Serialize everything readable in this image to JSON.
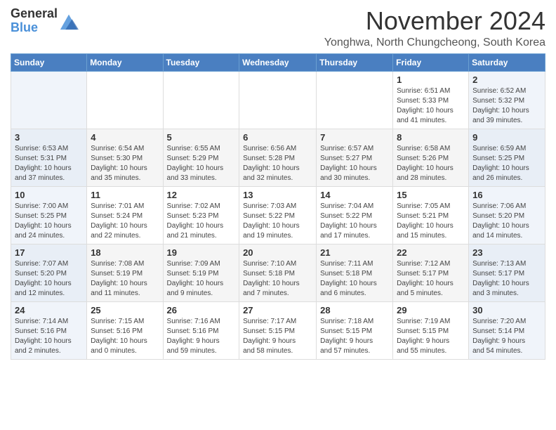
{
  "header": {
    "logo_general": "General",
    "logo_blue": "Blue",
    "month_title": "November 2024",
    "location": "Yonghwa, North Chungcheong, South Korea"
  },
  "weekdays": [
    "Sunday",
    "Monday",
    "Tuesday",
    "Wednesday",
    "Thursday",
    "Friday",
    "Saturday"
  ],
  "weeks": [
    [
      {
        "day": "",
        "info": ""
      },
      {
        "day": "",
        "info": ""
      },
      {
        "day": "",
        "info": ""
      },
      {
        "day": "",
        "info": ""
      },
      {
        "day": "",
        "info": ""
      },
      {
        "day": "1",
        "info": "Sunrise: 6:51 AM\nSunset: 5:33 PM\nDaylight: 10 hours\nand 41 minutes."
      },
      {
        "day": "2",
        "info": "Sunrise: 6:52 AM\nSunset: 5:32 PM\nDaylight: 10 hours\nand 39 minutes."
      }
    ],
    [
      {
        "day": "3",
        "info": "Sunrise: 6:53 AM\nSunset: 5:31 PM\nDaylight: 10 hours\nand 37 minutes."
      },
      {
        "day": "4",
        "info": "Sunrise: 6:54 AM\nSunset: 5:30 PM\nDaylight: 10 hours\nand 35 minutes."
      },
      {
        "day": "5",
        "info": "Sunrise: 6:55 AM\nSunset: 5:29 PM\nDaylight: 10 hours\nand 33 minutes."
      },
      {
        "day": "6",
        "info": "Sunrise: 6:56 AM\nSunset: 5:28 PM\nDaylight: 10 hours\nand 32 minutes."
      },
      {
        "day": "7",
        "info": "Sunrise: 6:57 AM\nSunset: 5:27 PM\nDaylight: 10 hours\nand 30 minutes."
      },
      {
        "day": "8",
        "info": "Sunrise: 6:58 AM\nSunset: 5:26 PM\nDaylight: 10 hours\nand 28 minutes."
      },
      {
        "day": "9",
        "info": "Sunrise: 6:59 AM\nSunset: 5:25 PM\nDaylight: 10 hours\nand 26 minutes."
      }
    ],
    [
      {
        "day": "10",
        "info": "Sunrise: 7:00 AM\nSunset: 5:25 PM\nDaylight: 10 hours\nand 24 minutes."
      },
      {
        "day": "11",
        "info": "Sunrise: 7:01 AM\nSunset: 5:24 PM\nDaylight: 10 hours\nand 22 minutes."
      },
      {
        "day": "12",
        "info": "Sunrise: 7:02 AM\nSunset: 5:23 PM\nDaylight: 10 hours\nand 21 minutes."
      },
      {
        "day": "13",
        "info": "Sunrise: 7:03 AM\nSunset: 5:22 PM\nDaylight: 10 hours\nand 19 minutes."
      },
      {
        "day": "14",
        "info": "Sunrise: 7:04 AM\nSunset: 5:22 PM\nDaylight: 10 hours\nand 17 minutes."
      },
      {
        "day": "15",
        "info": "Sunrise: 7:05 AM\nSunset: 5:21 PM\nDaylight: 10 hours\nand 15 minutes."
      },
      {
        "day": "16",
        "info": "Sunrise: 7:06 AM\nSunset: 5:20 PM\nDaylight: 10 hours\nand 14 minutes."
      }
    ],
    [
      {
        "day": "17",
        "info": "Sunrise: 7:07 AM\nSunset: 5:20 PM\nDaylight: 10 hours\nand 12 minutes."
      },
      {
        "day": "18",
        "info": "Sunrise: 7:08 AM\nSunset: 5:19 PM\nDaylight: 10 hours\nand 11 minutes."
      },
      {
        "day": "19",
        "info": "Sunrise: 7:09 AM\nSunset: 5:19 PM\nDaylight: 10 hours\nand 9 minutes."
      },
      {
        "day": "20",
        "info": "Sunrise: 7:10 AM\nSunset: 5:18 PM\nDaylight: 10 hours\nand 7 minutes."
      },
      {
        "day": "21",
        "info": "Sunrise: 7:11 AM\nSunset: 5:18 PM\nDaylight: 10 hours\nand 6 minutes."
      },
      {
        "day": "22",
        "info": "Sunrise: 7:12 AM\nSunset: 5:17 PM\nDaylight: 10 hours\nand 5 minutes."
      },
      {
        "day": "23",
        "info": "Sunrise: 7:13 AM\nSunset: 5:17 PM\nDaylight: 10 hours\nand 3 minutes."
      }
    ],
    [
      {
        "day": "24",
        "info": "Sunrise: 7:14 AM\nSunset: 5:16 PM\nDaylight: 10 hours\nand 2 minutes."
      },
      {
        "day": "25",
        "info": "Sunrise: 7:15 AM\nSunset: 5:16 PM\nDaylight: 10 hours\nand 0 minutes."
      },
      {
        "day": "26",
        "info": "Sunrise: 7:16 AM\nSunset: 5:16 PM\nDaylight: 9 hours\nand 59 minutes."
      },
      {
        "day": "27",
        "info": "Sunrise: 7:17 AM\nSunset: 5:15 PM\nDaylight: 9 hours\nand 58 minutes."
      },
      {
        "day": "28",
        "info": "Sunrise: 7:18 AM\nSunset: 5:15 PM\nDaylight: 9 hours\nand 57 minutes."
      },
      {
        "day": "29",
        "info": "Sunrise: 7:19 AM\nSunset: 5:15 PM\nDaylight: 9 hours\nand 55 minutes."
      },
      {
        "day": "30",
        "info": "Sunrise: 7:20 AM\nSunset: 5:14 PM\nDaylight: 9 hours\nand 54 minutes."
      }
    ]
  ]
}
